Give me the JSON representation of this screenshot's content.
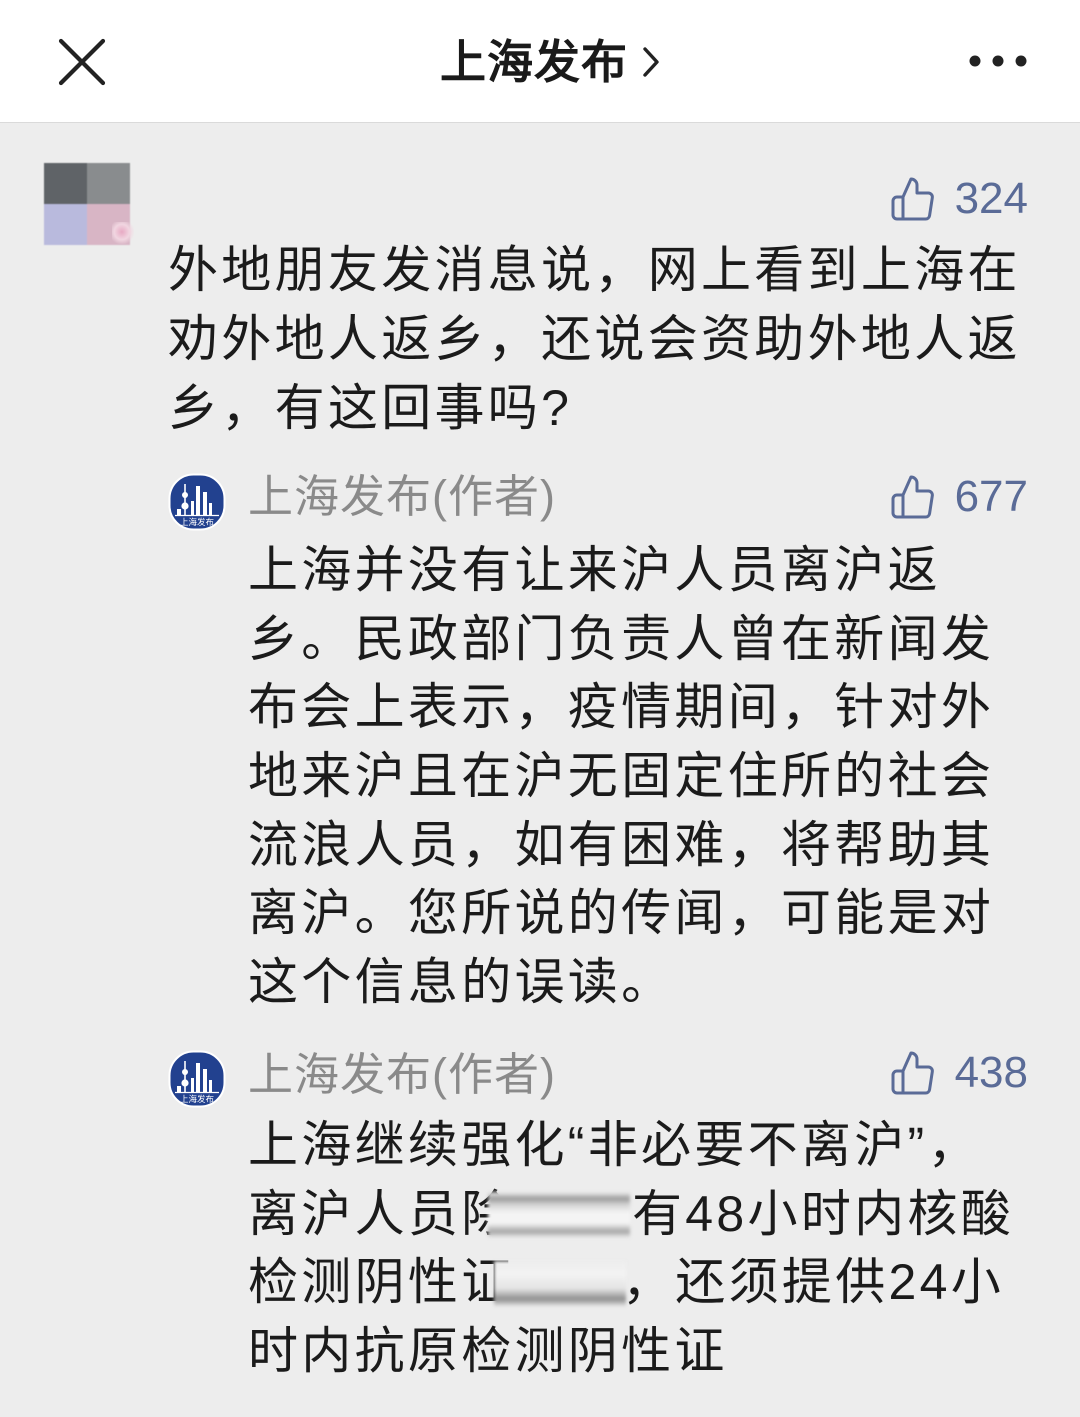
{
  "topbar": {
    "title": "上海发布",
    "close_icon": "close-icon",
    "chevron_icon": "chevron-right-icon",
    "more_icon": "more-icon"
  },
  "colors": {
    "topbar_bg": "#ffffff",
    "page_bg": "#ededed",
    "text": "#1b1b1b",
    "author": "#8a8a8a",
    "like": "#5a6b97",
    "logo": "#22418f"
  },
  "comment": {
    "avatar_icon": "blurred-avatar",
    "likes": "324",
    "lines": [
      "外地朋友发消息说，网上看到上海在",
      "劝外地人返乡，还说会资助外地人返",
      "乡，有这回事吗?"
    ]
  },
  "replies": [
    {
      "logo_text": "上海发布",
      "author": "上海发布(作者)",
      "likes": "677",
      "lines": [
        "上海并没有让来沪人员离沪返",
        "乡。民政部门负责人曾在新闻发",
        "布会上表示，疫情期间，针对外",
        "地来沪且在沪无固定住所的社会",
        "流浪人员，如有困难，将帮助其",
        "离沪。您所说的传闻，可能是对",
        "这个信息的误读。"
      ]
    },
    {
      "logo_text": "上海发布",
      "author": "上海发布(作者)",
      "likes": "438",
      "lines": [
        "上海继续强化“非必要不离沪”，",
        {
          "before": "离沪人员除",
          "after": "有48小时内核酸"
        },
        {
          "before": "检测阴性证",
          "after": "，还须提供24小"
        },
        "时内抗原检测阴性证"
      ]
    }
  ]
}
